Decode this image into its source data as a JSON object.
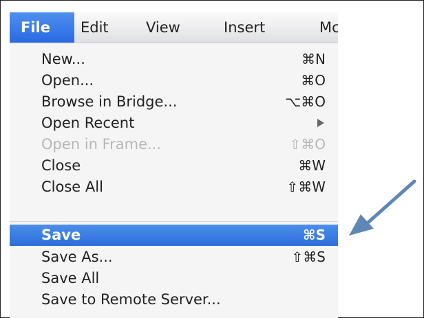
{
  "menubar": {
    "items": [
      {
        "label": "File",
        "selected": true
      },
      {
        "label": "Edit"
      },
      {
        "label": "View"
      },
      {
        "label": "Insert"
      },
      {
        "label": "Mc"
      }
    ]
  },
  "file_menu": {
    "items": [
      {
        "label": "New...",
        "shortcut": "⌘N"
      },
      {
        "label": "Open...",
        "shortcut": "⌘O"
      },
      {
        "label": "Browse in Bridge...",
        "shortcut": "⌥⌘O"
      },
      {
        "label": "Open Recent",
        "submenu": true
      },
      {
        "label": "Open in Frame...",
        "shortcut": "⇧⌘O",
        "disabled": true
      },
      {
        "label": "Close",
        "shortcut": "⌘W"
      },
      {
        "label": "Close All",
        "shortcut": "⇧⌘W"
      },
      {
        "label": "Save",
        "shortcut": "⌘S",
        "selected": true
      },
      {
        "label": "Save As...",
        "shortcut": "⇧⌘S"
      },
      {
        "label": "Save All",
        "shortcut": ""
      },
      {
        "label": "Save to Remote Server...",
        "shortcut": ""
      }
    ]
  },
  "colors": {
    "highlight": "#2c6fdb",
    "annotation_arrow": "#5f87b6"
  },
  "icons": {
    "submenu": "submenu-arrow-icon",
    "annotation": "pointer-arrow-icon"
  }
}
